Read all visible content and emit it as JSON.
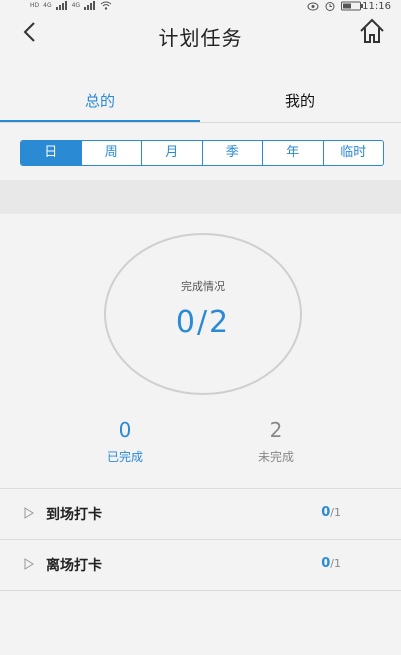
{
  "status_bar": {
    "time": "11:16",
    "net_left": "4G",
    "net_left2": "4G"
  },
  "header": {
    "title": "计划任务"
  },
  "tabs": [
    {
      "label": "总的"
    },
    {
      "label": "我的"
    }
  ],
  "period_filter": {
    "selected": "日",
    "options": [
      "日",
      "周",
      "月",
      "季",
      "年",
      "临时"
    ]
  },
  "summary": {
    "title": "完成情况",
    "progress_text": "0/2",
    "completed": {
      "count": "0",
      "label": "已完成"
    },
    "incomplete": {
      "count": "2",
      "label": "未完成"
    }
  },
  "tasks": [
    {
      "name": "到场打卡",
      "done": "0",
      "total": "/1"
    },
    {
      "name": "离场打卡",
      "done": "0",
      "total": "/1"
    }
  ],
  "colors": {
    "accent": "#2a8ad4",
    "muted": "#888888"
  }
}
